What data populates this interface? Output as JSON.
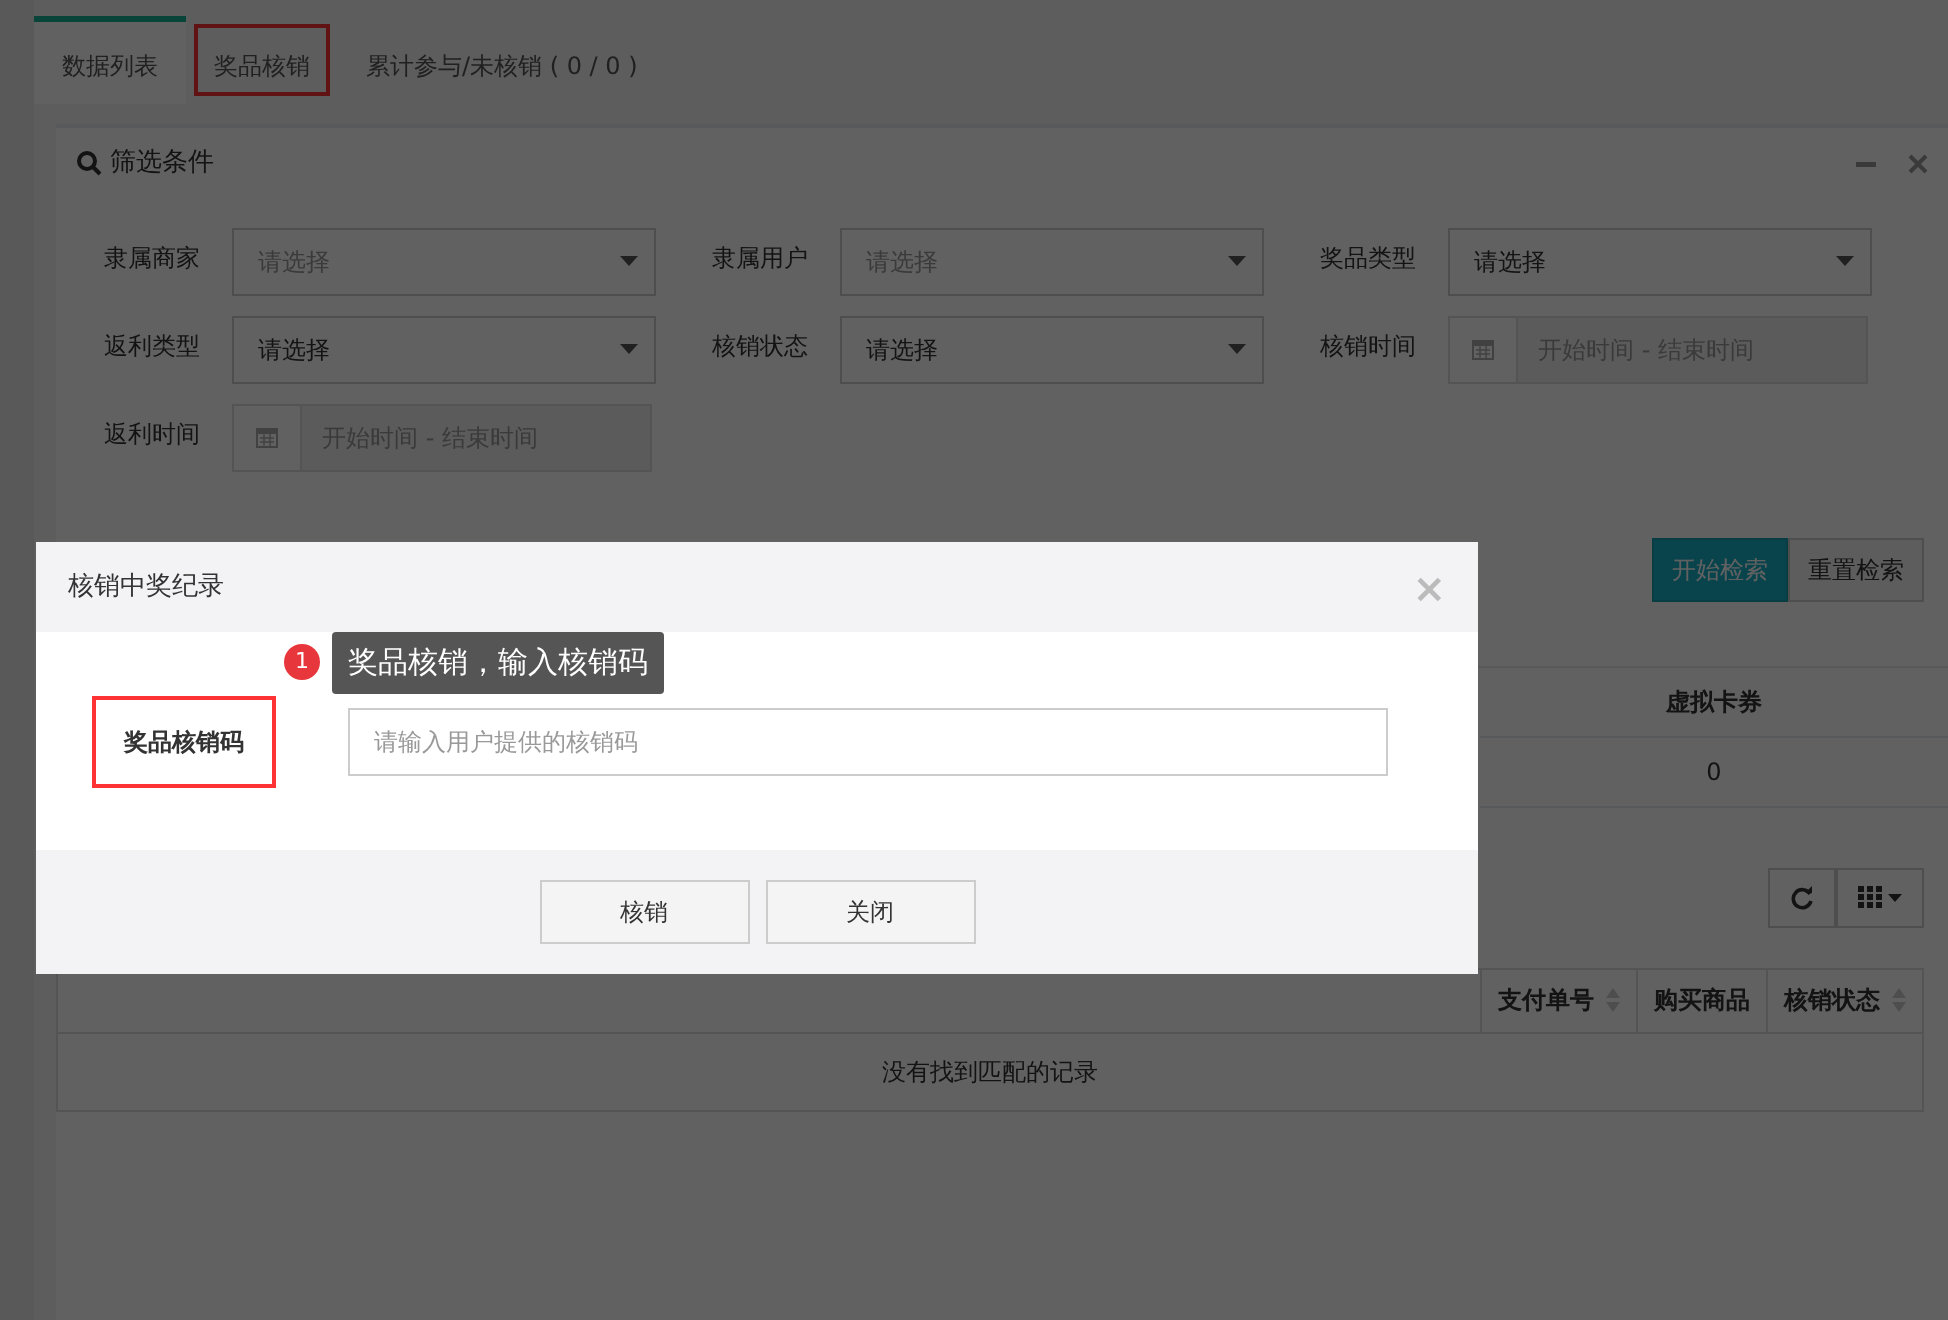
{
  "tabs": [
    {
      "label": "数据列表",
      "selected": true,
      "highlighted": false
    },
    {
      "label": "奖品核销",
      "selected": false,
      "highlighted": true
    },
    {
      "label": "累计参与/未核销 ( 0 / 0 )",
      "selected": false,
      "highlighted": false
    }
  ],
  "filter_panel": {
    "title": "筛选条件",
    "fields": [
      {
        "label": "隶属商家",
        "kind": "select",
        "placeholder": "请选择"
      },
      {
        "label": "隶属用户",
        "kind": "select",
        "placeholder": "请选择"
      },
      {
        "label": "奖品类型",
        "kind": "select",
        "value": "请选择"
      },
      {
        "label": "返利类型",
        "kind": "select",
        "value": "请选择"
      },
      {
        "label": "核销状态",
        "kind": "select",
        "value": "请选择"
      },
      {
        "label": "核销时间",
        "kind": "daterange",
        "placeholder": "开始时间 - 结束时间"
      },
      {
        "label": "返利时间",
        "kind": "daterange",
        "placeholder": "开始时间 - 结束时间"
      }
    ],
    "buttons": [
      {
        "label": "开始检索",
        "kind": "primary"
      },
      {
        "label": "重置检索",
        "kind": "default"
      }
    ]
  },
  "summary": {
    "columns": [
      "虚拟卡券"
    ],
    "values": [
      "0"
    ]
  },
  "table": {
    "columns": [
      {
        "label": "支付单号",
        "sortable": true
      },
      {
        "label": "购买商品",
        "sortable": false
      },
      {
        "label": "核销状态",
        "sortable": true
      }
    ],
    "empty_text": "没有找到匹配的记录"
  },
  "modal": {
    "title": "核销中奖纪录",
    "close": "×",
    "field": {
      "label": "奖品核销码",
      "highlighted": true,
      "placeholder": "请输入用户提供的核销码"
    },
    "annotation": {
      "number": "1",
      "text": "奖品核销，输入核销码"
    },
    "buttons": [
      "核销",
      "关闭"
    ]
  }
}
